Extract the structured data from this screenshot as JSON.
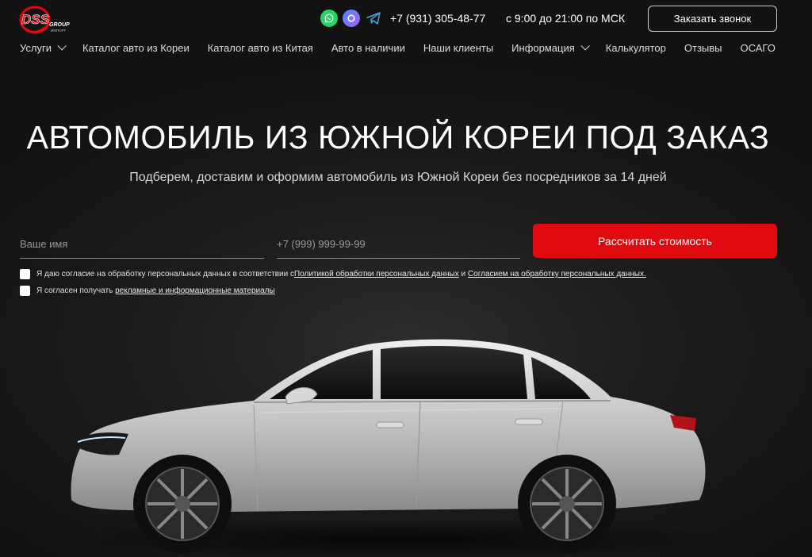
{
  "header": {
    "logo": {
      "brand": "DSS",
      "sub1": "GROUP",
      "sub2": "ИМПОРТ"
    },
    "messengers": [
      "whatsapp-icon",
      "max-messenger-icon",
      "telegram-icon"
    ],
    "phone": "+7 (931) 305-48-77",
    "hours": "с 9:00 до 21:00 по МСК",
    "callback_label": "Заказать звонок"
  },
  "nav": {
    "items": [
      {
        "label": "Услуги",
        "has_dropdown": true
      },
      {
        "label": "Каталог авто из Кореи"
      },
      {
        "label": "Каталог авто из Китая"
      },
      {
        "label": "Авто в наличии"
      },
      {
        "label": "Наши клиенты"
      },
      {
        "label": "Информация",
        "has_dropdown": true
      },
      {
        "label": "Калькулятор"
      },
      {
        "label": "Отзывы"
      },
      {
        "label": "ОСАГО"
      }
    ]
  },
  "hero": {
    "title": "АВТОМОБИЛЬ ИЗ ЮЖНОЙ КОРЕИ ПОД ЗАКАЗ",
    "subtitle": "Подберем, доставим и оформим автомобиль из Южной Кореи без посредников за 14 дней"
  },
  "form": {
    "name_placeholder": "Ваше имя",
    "phone_placeholder": "+7 (999) 999-99-99",
    "submit_label": "Рассчитать стоимость",
    "consent_1": {
      "text": "Я даю согласие на обработку персональных данных в соответствии с ",
      "link1": "Политикой обработки персональных данных",
      "and": " и ",
      "link2": "Согласием на обработку персональных данных."
    },
    "consent_2": {
      "text": "Я согласен получать ",
      "link": "рекламные и информационные материалы"
    }
  },
  "colors": {
    "accent": "#e00910",
    "background": "#141414",
    "header": "#121212"
  }
}
